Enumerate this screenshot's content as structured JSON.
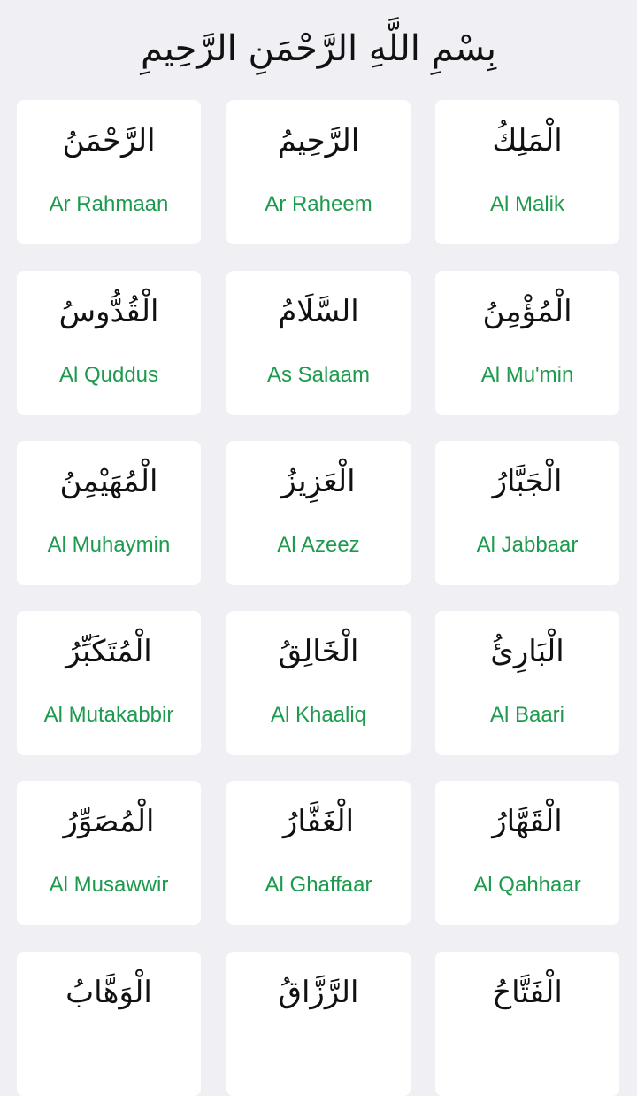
{
  "header": {
    "bismillah": "بِسْمِ اللَّهِ الرَّحْمَنِ الرَّحِيمِ"
  },
  "colors": {
    "background": "#efeff4",
    "card": "#ffffff",
    "accent_green": "#1e9a4e",
    "text": "#111111"
  },
  "names": [
    {
      "arabic": "الرَّحْمَنُ",
      "transliteration": "Ar Rahmaan"
    },
    {
      "arabic": "الرَّحِيمُ",
      "transliteration": "Ar Raheem"
    },
    {
      "arabic": "الْمَلِكُ",
      "transliteration": "Al Malik"
    },
    {
      "arabic": "الْقُدُّوسُ",
      "transliteration": "Al Quddus"
    },
    {
      "arabic": "السَّلَامُ",
      "transliteration": "As Salaam"
    },
    {
      "arabic": "الْمُؤْمِنُ",
      "transliteration": "Al Mu'min"
    },
    {
      "arabic": "الْمُهَيْمِنُ",
      "transliteration": "Al Muhaymin"
    },
    {
      "arabic": "الْعَزِيزُ",
      "transliteration": "Al Azeez"
    },
    {
      "arabic": "الْجَبَّارُ",
      "transliteration": "Al Jabbaar"
    },
    {
      "arabic": "الْمُتَكَبِّرُ",
      "transliteration": "Al Mutakabbir"
    },
    {
      "arabic": "الْخَالِقُ",
      "transliteration": "Al Khaaliq"
    },
    {
      "arabic": "الْبَارِئُ",
      "transliteration": "Al Baari"
    },
    {
      "arabic": "الْمُصَوِّرُ",
      "transliteration": "Al Musawwir"
    },
    {
      "arabic": "الْغَفَّارُ",
      "transliteration": "Al Ghaffaar"
    },
    {
      "arabic": "الْقَهَّارُ",
      "transliteration": "Al Qahhaar"
    },
    {
      "arabic": "الْوَهَّابُ",
      "transliteration": ""
    },
    {
      "arabic": "الرَّزَّاقُ",
      "transliteration": ""
    },
    {
      "arabic": "الْفَتَّاحُ",
      "transliteration": ""
    }
  ]
}
